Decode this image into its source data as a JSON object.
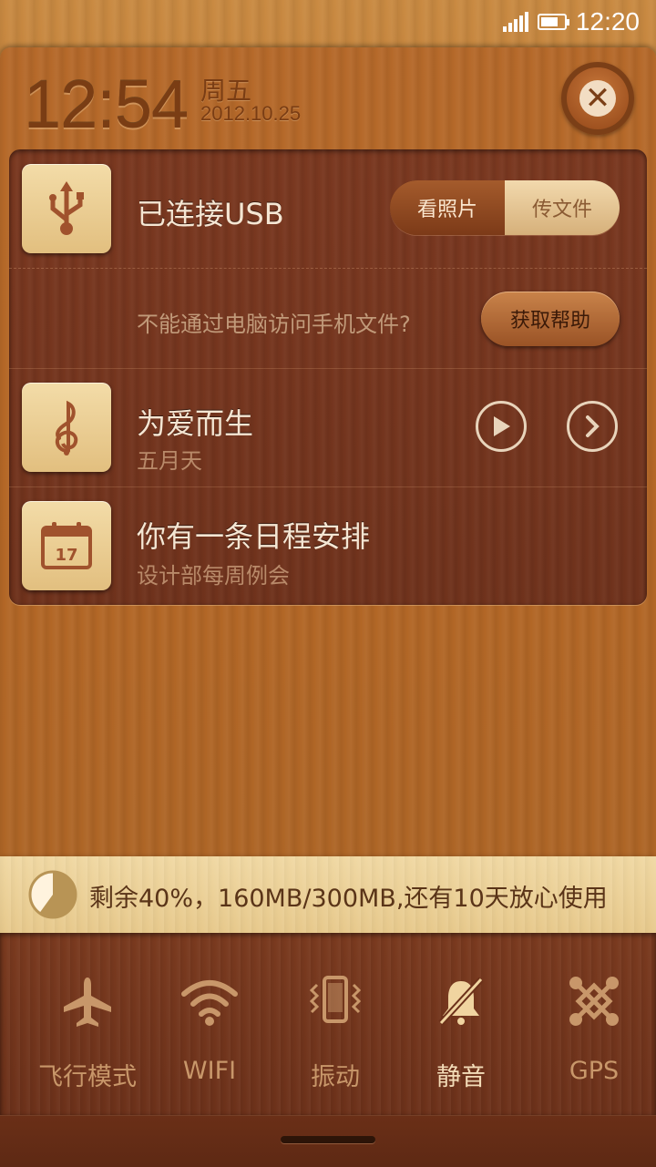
{
  "status_bar": {
    "time": "12:20"
  },
  "header": {
    "clock": "12:54",
    "weekday": "周五",
    "date": "2012.10.25"
  },
  "notifications": {
    "usb": {
      "title": "已连接USB",
      "options": [
        "看照片",
        "传文件"
      ],
      "selected": "传文件",
      "help_text": "不能通过电脑访问手机文件?",
      "help_button": "获取帮助"
    },
    "music": {
      "title": "为爱而生",
      "artist": "五月天"
    },
    "calendar": {
      "title": "你有一条日程安排",
      "subtitle": "设计部每周例会",
      "icon_day": "17"
    }
  },
  "usage": {
    "text": "剩余40%，160MB/300MB,还有10天放心使用",
    "remaining_fraction": 0.4
  },
  "toggles": [
    {
      "label": "飞行模式",
      "icon": "airplane-icon",
      "active": false
    },
    {
      "label": "WIFI",
      "icon": "wifi-icon",
      "active": false
    },
    {
      "label": "振动",
      "icon": "vibrate-icon",
      "active": false
    },
    {
      "label": "静音",
      "icon": "mute-icon",
      "active": true
    },
    {
      "label": "GPS",
      "icon": "gps-icon",
      "active": false
    }
  ],
  "colors": {
    "accent_light": "#f2d9ad",
    "wood_dark": "#6f321c",
    "text_light": "#f5e6d3"
  }
}
